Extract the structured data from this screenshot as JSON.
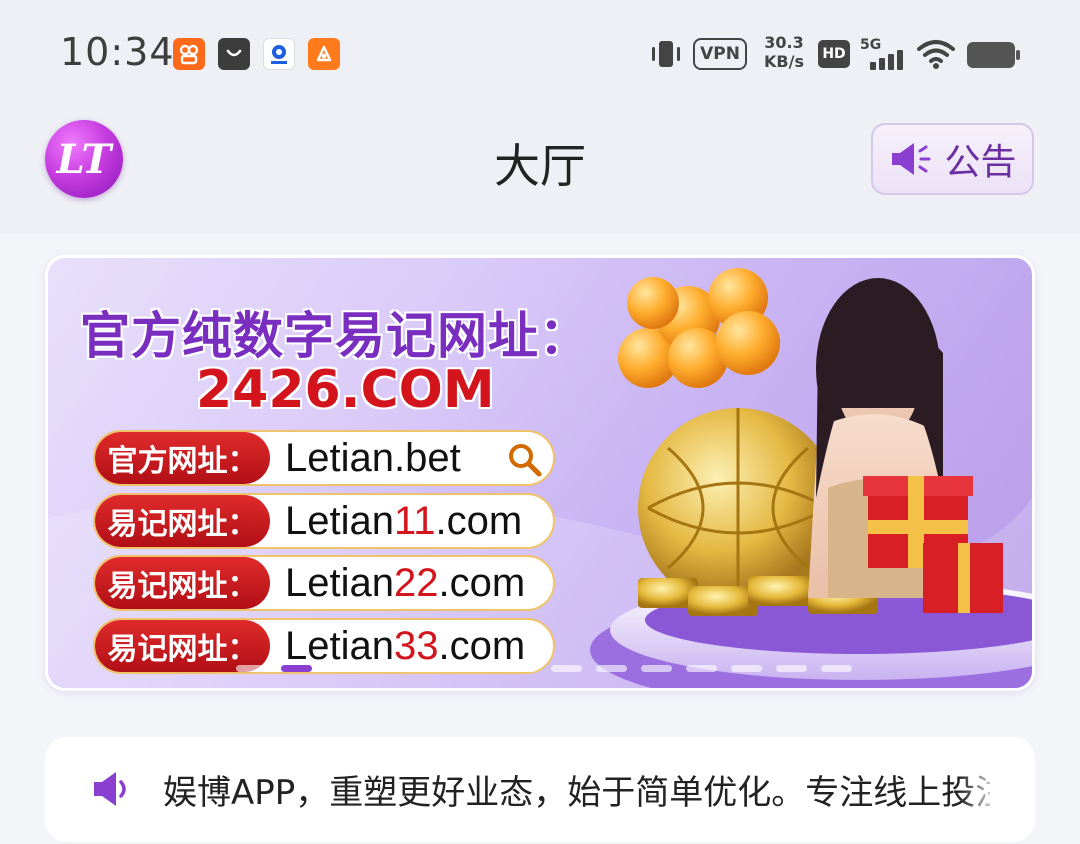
{
  "status_bar": {
    "time": "10:34",
    "vpn": "VPN",
    "net_speed_value": "30.3",
    "net_speed_unit": "KB/s",
    "hd": "HD",
    "network": "5G",
    "icons": [
      "app-notify-icon-1",
      "app-notify-icon-2",
      "app-notify-icon-3",
      "app-notify-icon-4",
      "vibrate-icon",
      "signal-icon",
      "wifi-icon",
      "battery-icon"
    ]
  },
  "header": {
    "logo": "LT",
    "title": "大厅",
    "notice_label": "公告"
  },
  "banner": {
    "headline": "官方纯数字易记网址：",
    "domain": "2426.COM",
    "rows": [
      {
        "tag": "官方网址：",
        "url_prefix": "Letian",
        "url_highlight": "",
        "url_suffix": ".bet"
      },
      {
        "tag": "易记网址：",
        "url_prefix": "Letian",
        "url_highlight": "11",
        "url_suffix": ".com"
      },
      {
        "tag": "易记网址：",
        "url_prefix": "Letian",
        "url_highlight": "22",
        "url_suffix": ".com"
      },
      {
        "tag": "易记网址：",
        "url_prefix": "Letian",
        "url_highlight": "33",
        "url_suffix": ".com"
      }
    ],
    "carousel_total": 14,
    "carousel_active_index": 1
  },
  "marquee": {
    "text": "娱博APP，重塑更好业态，始于简单优化。专注线上投注"
  },
  "colors": {
    "accent": "#8a3fd1",
    "brand_red": "#d3141c",
    "background": "#eef0f5"
  }
}
